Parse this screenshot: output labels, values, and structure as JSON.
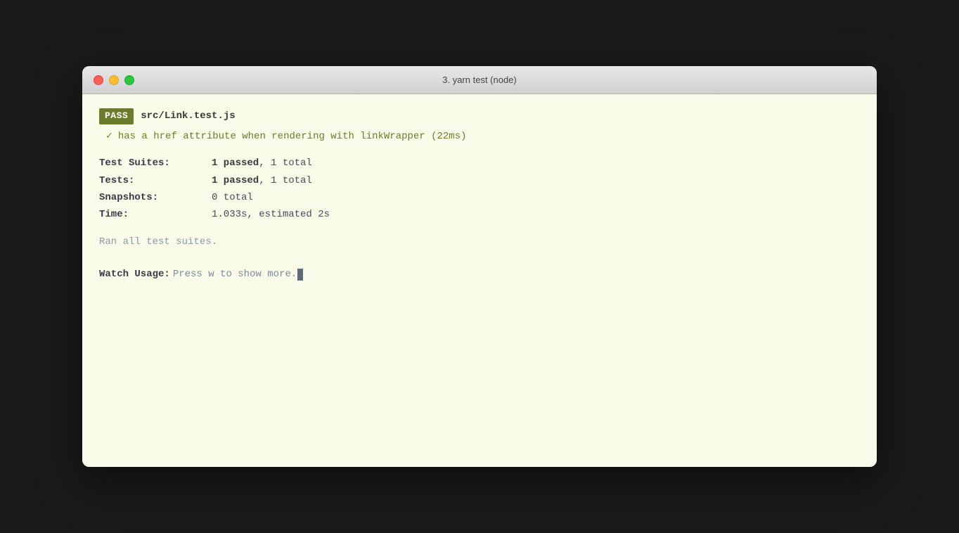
{
  "window": {
    "title": "3. yarn test (node)",
    "traffic_lights": {
      "close_label": "close",
      "minimize_label": "minimize",
      "maximize_label": "maximize"
    }
  },
  "terminal": {
    "pass_badge": "PASS",
    "pass_file_prefix": "src/",
    "pass_file_name": "Link.test.js",
    "test_result": "✓ has a href attribute when rendering with linkWrapper (22ms)",
    "stats": {
      "test_suites_label": "Test Suites:",
      "test_suites_value": "1 passed, 1 total",
      "test_suites_bold": "1 passed",
      "tests_label": "Tests:",
      "tests_value": "1 passed, 1 total",
      "tests_bold": "1 passed",
      "snapshots_label": "Snapshots:",
      "snapshots_value": "0 total",
      "time_label": "Time:",
      "time_value": "1.033s, estimated 2s"
    },
    "ran_all": "Ran all test suites.",
    "watch_usage_label": "Watch Usage:",
    "watch_usage_value": "Press w to show more."
  }
}
